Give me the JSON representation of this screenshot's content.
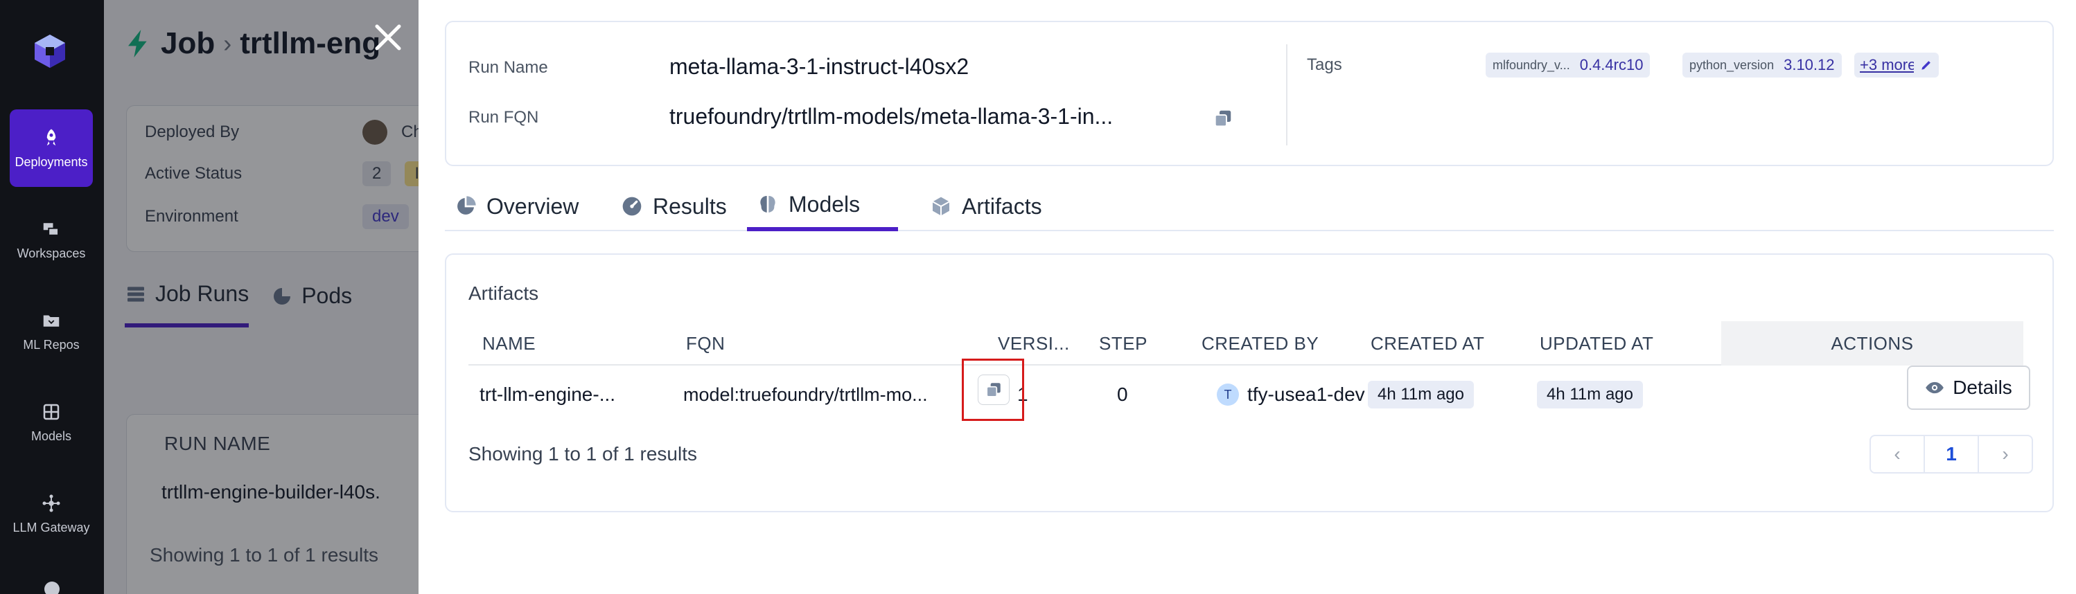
{
  "sidebar": {
    "items": [
      {
        "label": "Deployments",
        "icon": "rocket-icon",
        "active": true
      },
      {
        "label": "Workspaces",
        "icon": "workspaces-icon",
        "active": false
      },
      {
        "label": "ML Repos",
        "icon": "folder-icon",
        "active": false
      },
      {
        "label": "Models",
        "icon": "grid-icon",
        "active": false
      },
      {
        "label": "LLM Gateway",
        "icon": "gateway-icon",
        "active": false
      }
    ]
  },
  "background": {
    "breadcrumb_root": "Job",
    "breadcrumb_separator": "›",
    "breadcrumb_current": "trtllm-eng",
    "deployed_by_label": "Deployed By",
    "deployed_by_value": "Chir",
    "active_status_label": "Active Status",
    "active_status_value": "2",
    "active_status_badge": "II",
    "environment_label": "Environment",
    "environment_value": "dev",
    "tabs": [
      {
        "label": "Job Runs",
        "active": true
      },
      {
        "label": "Pods",
        "active": false
      }
    ],
    "table_header": "RUN NAME",
    "table_row": "trtllm-engine-builder-l40s.",
    "showing": "Showing 1 to 1 of 1 results"
  },
  "run": {
    "name_label": "Run Name",
    "name_value": "meta-llama-3-1-instruct-l40sx2",
    "fqn_label": "Run FQN",
    "fqn_value": "truefoundry/trtllm-models/meta-llama-3-1-in...",
    "tags_label": "Tags",
    "tags": [
      {
        "key": "mlfoundry_v...",
        "value": "0.4.4rc10"
      },
      {
        "key": "python_version",
        "value": "3.10.12"
      }
    ],
    "more_tags": "+3 more"
  },
  "tabs": [
    {
      "label": "Overview",
      "icon": "pie-chart-icon",
      "active": false
    },
    {
      "label": "Results",
      "icon": "gauge-icon",
      "active": false
    },
    {
      "label": "Models",
      "icon": "brain-icon",
      "active": true
    },
    {
      "label": "Artifacts",
      "icon": "box-icon",
      "active": false
    }
  ],
  "artifacts": {
    "title": "Artifacts",
    "columns": [
      "NAME",
      "FQN",
      "VERSI...",
      "STEP",
      "CREATED BY",
      "CREATED AT",
      "UPDATED AT",
      "ACTIONS"
    ],
    "rows": [
      {
        "name": "trt-llm-engine-...",
        "fqn": "model:truefoundry/trtllm-mo...",
        "version": "1",
        "step": "0",
        "created_by_initial": "T",
        "created_by": "tfy-usea1-dev",
        "created_at": "4h 11m ago",
        "updated_at": "4h 11m ago",
        "action": "Details"
      }
    ],
    "showing": "Showing 1 to 1 of 1 results",
    "pagination": {
      "prev": "‹",
      "page": "1",
      "next": "›"
    }
  },
  "colors": {
    "accent": "#4c1fc7",
    "highlight_box": "#d61b1b",
    "sidebar_bg": "#111318"
  }
}
